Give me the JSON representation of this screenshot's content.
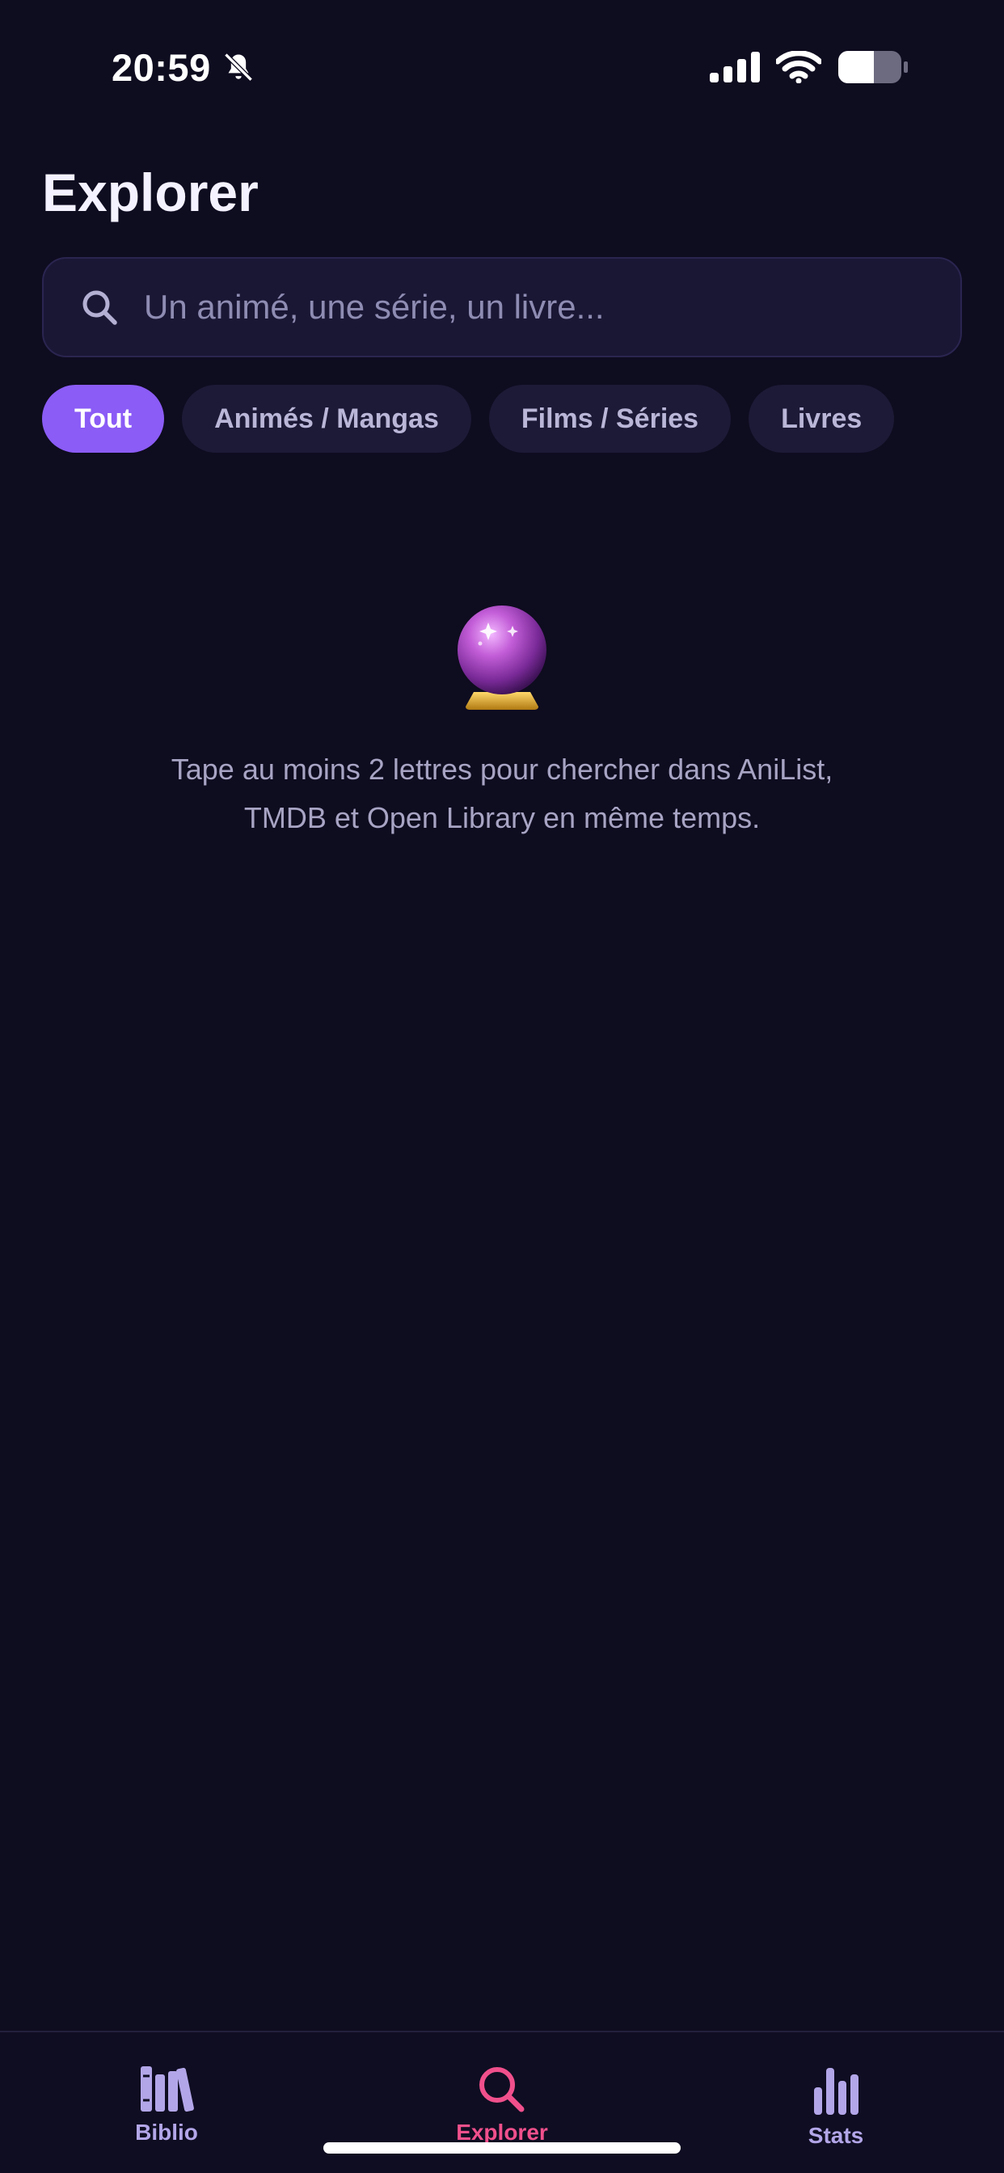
{
  "status_bar": {
    "time": "20:59",
    "icons": [
      "bell-slash-icon",
      "signal-icon",
      "wifi-icon",
      "battery-icon"
    ]
  },
  "header": {
    "title": "Explorer"
  },
  "search": {
    "placeholder": "Un animé, une série, un livre...",
    "value": ""
  },
  "filters": {
    "items": [
      {
        "label": "Tout",
        "active": true
      },
      {
        "label": "Animés / Mangas",
        "active": false
      },
      {
        "label": "Films / Séries",
        "active": false
      },
      {
        "label": "Livres",
        "active": false
      }
    ]
  },
  "empty_state": {
    "icon": "crystal-ball-icon",
    "line1": "Tape au moins 2 lettres pour chercher dans AniList,",
    "line2": "TMDB et Open Library en même temps."
  },
  "tabbar": {
    "items": [
      {
        "label": "Biblio",
        "icon": "books-icon",
        "active": false
      },
      {
        "label": "Explorer",
        "icon": "search-icon",
        "active": true
      },
      {
        "label": "Stats",
        "icon": "bar-chart-icon",
        "active": false
      }
    ]
  },
  "colors": {
    "background": "#0e0c1f",
    "accent": "#8b5cf6",
    "active_tab": "#f0508c",
    "muted_tab": "#b3a6e8"
  }
}
